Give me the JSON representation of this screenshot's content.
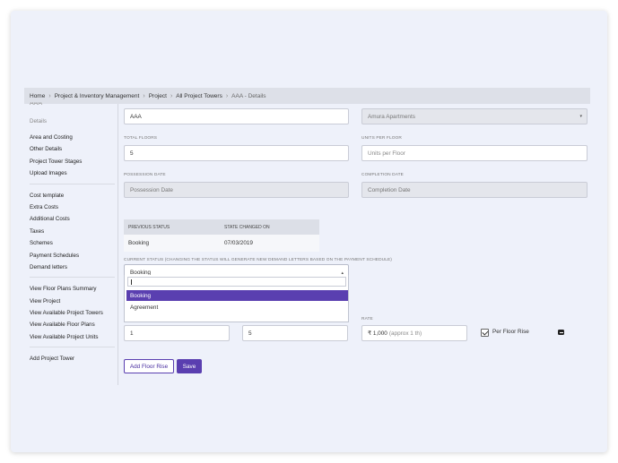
{
  "breadcrumb": [
    "Home",
    "Project & Inventory Management",
    "Project",
    "All Project Towers",
    "AAA - Details"
  ],
  "cut_title": "AAA",
  "sidebar": {
    "head": "Details",
    "groups": [
      [
        "Area and Costing",
        "Other Details",
        "Project Tower Stages",
        "Upload Images"
      ],
      [
        "Cost template",
        "Extra Costs",
        "Additional Costs",
        "Taxes",
        "Schemes",
        "Payment Schedules",
        "Demand letters"
      ],
      [
        "View Floor Plans Summary",
        "View Project",
        "View Available Project Towers",
        "View Available Floor Plans",
        "View Available Project Units"
      ],
      [
        "Add Project Tower"
      ]
    ]
  },
  "form": {
    "tower_name": "AAA",
    "project": "Amura Apartments",
    "total_floors_label": "TOTAL FLOORS",
    "total_floors": "5",
    "units_per_floor_label": "UNITS PER FLOOR",
    "units_per_floor_placeholder": "Units per Floor",
    "possession_date_label": "POSSESSION DATE",
    "possession_date_placeholder": "Possession Date",
    "completion_date_label": "COMPLETION DATE",
    "completion_date_placeholder": "Completion Date"
  },
  "status_table": {
    "headers": [
      "PREVIOUS STATUS",
      "STATE CHANGED ON"
    ],
    "rows": [
      [
        "Booking",
        "07/03/2019"
      ]
    ]
  },
  "current_status": {
    "label": "CURRENT STATUS (CHANGING THE STATUS WILL GENERATE NEW DEMAND LETTERS BASED ON THE PAYMENT SCHEDULE)",
    "value": "Booking",
    "options": [
      "Booking",
      "Agreement"
    ]
  },
  "floor_rise": {
    "from": "1",
    "to": "5",
    "rate_label": "RATE",
    "rate": "₹ 1,000",
    "rate_hint": "(approx 1 th)",
    "per_floor_rise_label": "Per Floor Rise",
    "per_floor_rise_checked": true
  },
  "buttons": {
    "add_floor_rise": "Add Floor Rise",
    "save": "Save"
  },
  "colors": {
    "accent": "#5a3fb0",
    "background": "#eef1fa"
  }
}
